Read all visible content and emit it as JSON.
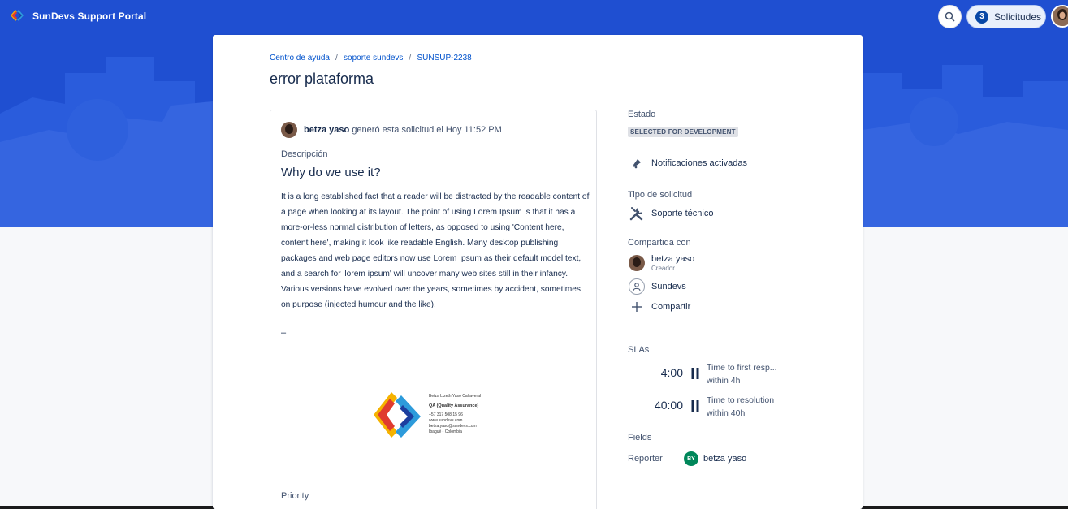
{
  "header": {
    "portal_title": "SunDevs Support Portal",
    "requests_count": "3",
    "requests_label": "Solicitudes"
  },
  "colors": {
    "hero_blue": "#1f4fd1",
    "link_blue": "#0052cc",
    "reporter_badge": "#00875a"
  },
  "breadcrumb": {
    "items": [
      "Centro de ayuda",
      "soporte sundevs",
      "SUNSUP-2238"
    ],
    "separator": "/"
  },
  "request": {
    "title": "error plataforma",
    "creator_name": "betza yaso",
    "creator_action": "generó esta solicitud el Hoy 11:52 PM",
    "description_label": "Descripción",
    "description_heading": "Why do we use it?",
    "description_body": "It is a long established fact that a reader will be distracted by the readable content of a page when looking at its layout. The point of using Lorem Ipsum is that it has a more-or-less normal distribution of letters, as opposed to using 'Content here, content here', making it look like readable English. Many desktop publishing packages and web page editors now use Lorem Ipsum as their default model text, and a search for 'lorem ipsum' will uncover many web sites still in their infancy. Various versions have evolved over the years, sometimes by accident, sometimes on purpose (injected humour and the like).",
    "description_dash": "–",
    "priority_label": "Priority"
  },
  "signature": {
    "name": "Betza Lizeth Yaso Cañaveral",
    "role": "QA (Quality Assurance)",
    "phone": "+57 317 508 15 96",
    "website": "www.sundevs.com",
    "email": "betza.yaso@sundevs.com",
    "location": "Ibagué - Colombia"
  },
  "sidebar": {
    "status_label": "Estado",
    "status_value": "SELECTED FOR DEVELOPMENT",
    "notifications_label": "Notificaciones activadas",
    "request_type_label": "Tipo de solicitud",
    "request_type_value": "Soporte técnico",
    "shared_label": "Compartida con",
    "shared_person_name": "betza yaso",
    "shared_person_role": "Creador",
    "shared_org": "Sundevs",
    "share_action": "Compartir",
    "slas_label": "SLAs",
    "slas": [
      {
        "time": "4:00",
        "name": "Time to first resp...",
        "target": "within 4h"
      },
      {
        "time": "40:00",
        "name": "Time to resolution",
        "target": "within 40h"
      }
    ],
    "fields_label": "Fields",
    "reporter_label": "Reporter",
    "reporter_initials": "BY",
    "reporter_name": "betza yaso"
  }
}
